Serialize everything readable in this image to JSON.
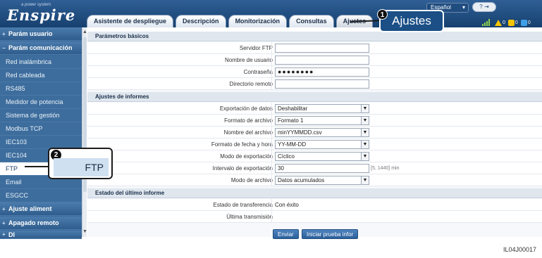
{
  "header": {
    "logo_tagline": "a power system",
    "logo": "Enspire",
    "language": "Español",
    "tabs": [
      {
        "label": "Asistente de despliegue"
      },
      {
        "label": "Descripción"
      },
      {
        "label": "Monitorización"
      },
      {
        "label": "Consultas"
      },
      {
        "label": "Ajustes",
        "active": true
      }
    ],
    "alarm_counts": [
      "0",
      "0",
      "0"
    ]
  },
  "sidebar": {
    "items": [
      {
        "label": "Parám usuario",
        "type": "group"
      },
      {
        "label": "Parám comunicación",
        "type": "group"
      },
      {
        "label": "Red inalámbrica",
        "type": "sub"
      },
      {
        "label": "Red cableada",
        "type": "sub"
      },
      {
        "label": "RS485",
        "type": "sub"
      },
      {
        "label": "Medidor de potencia",
        "type": "sub"
      },
      {
        "label": "Sistema de gestión",
        "type": "sub"
      },
      {
        "label": "Modbus TCP",
        "type": "sub"
      },
      {
        "label": "IEC103",
        "type": "sub"
      },
      {
        "label": "IEC104",
        "type": "sub"
      },
      {
        "label": "FTP",
        "type": "sub",
        "selected": true
      },
      {
        "label": "Email",
        "type": "sub"
      },
      {
        "label": "ESGCC",
        "type": "sub"
      },
      {
        "label": "Ajuste aliment",
        "type": "group"
      },
      {
        "label": "Apagado remoto",
        "type": "group"
      },
      {
        "label": "DI",
        "type": "group"
      }
    ]
  },
  "main": {
    "sections": {
      "basic": "Parámetros básicos",
      "reports": "Ajustes de informes",
      "last_report": "Estado del último informe"
    },
    "basic_fields": {
      "ftp_server": {
        "label": "Servidor FTP",
        "value": ""
      },
      "username": {
        "label": "Nombre de usuario",
        "value": ""
      },
      "password": {
        "label": "Contraseña",
        "value": "●●●●●●●●"
      },
      "remote_dir": {
        "label": "Directorio remoto",
        "value": ""
      }
    },
    "report_fields": {
      "data_export": {
        "label": "Exportación de datos",
        "value": "Deshabilitar"
      },
      "file_format": {
        "label": "Formato de archivo",
        "value": "Formato 1"
      },
      "file_name": {
        "label": "Nombre del archivo",
        "value": "minYYMMDD.csv"
      },
      "date_format": {
        "label": "Formato de fecha y hora",
        "value": "YY-MM-DD"
      },
      "export_mode": {
        "label": "Modo de exportación",
        "value": "Cíclico"
      },
      "export_interval": {
        "label": "Intervalo de exportación",
        "value": "30",
        "hint": "[5, 1440] min"
      },
      "file_mode": {
        "label": "Modo de archivo",
        "value": "Datos acumulados"
      }
    },
    "last_report": {
      "transfer_state": {
        "label": "Estado de transferencia",
        "value": "Con éxito"
      },
      "last_transmission": {
        "label": "Última transmisión",
        "value": ""
      }
    },
    "buttons": {
      "submit": "Enviar",
      "test": "Iniciar prueba infor"
    }
  },
  "callouts": {
    "c1": {
      "number": "1",
      "text": "Ajustes"
    },
    "c2": {
      "number": "2",
      "text": "FTP"
    }
  },
  "figure_id": "IL04J00017"
}
